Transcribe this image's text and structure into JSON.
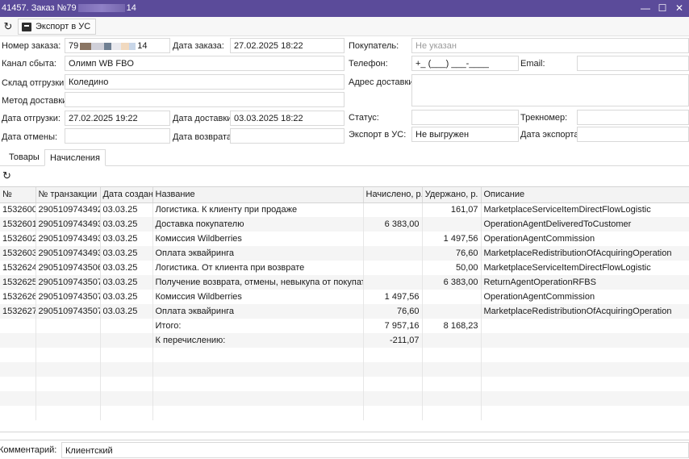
{
  "window": {
    "title_prefix": "41457. Заказ №79",
    "title_suffix": "14",
    "minimize": "—",
    "maximize": "☐",
    "close": "✕"
  },
  "toolbar": {
    "export_label": "Экспорт в УС"
  },
  "form": {
    "order_number_label": "Номер заказа:",
    "order_number_prefix": "79",
    "order_number_suffix": "14",
    "order_date_label": "Дата заказа:",
    "order_date": "27.02.2025 18:22",
    "buyer_label": "Покупатель:",
    "buyer_placeholder": "Не указан",
    "channel_label": "Канал сбыта:",
    "channel": "Олимп WB FBO",
    "phone_label": "Телефон:",
    "phone_mask": "+_ (___) ___-____",
    "email_label": "Email:",
    "email": "",
    "warehouse_label": "Склад отгрузки:",
    "warehouse": "Коледино",
    "address_label": "Адрес доставки:",
    "address": "",
    "delivery_method_label": "Метод доставки:",
    "delivery_method": "",
    "ship_date_label": "Дата отгрузки:",
    "ship_date": "27.02.2025 19:22",
    "delivery_date_label": "Дата доставки:",
    "delivery_date": "03.03.2025 18:22",
    "status_label": "Статус:",
    "status": "",
    "track_label": "Трекномер:",
    "track": "",
    "cancel_date_label": "Дата отмены:",
    "cancel_date": "",
    "return_date_label": "Дата возврата:",
    "return_date": "",
    "export_us_label": "Экспорт в УС:",
    "export_us": "Не выгружен",
    "export_date_label": "Дата экспорта:",
    "export_date": ""
  },
  "tabs": [
    {
      "label": "Товары",
      "active": false
    },
    {
      "label": "Начисления",
      "active": true
    }
  ],
  "grid": {
    "columns": [
      "№",
      "№ транзакции",
      "Дата создан...",
      "Название",
      "Начислено, р.",
      "Удержано, р.",
      "Описание"
    ],
    "rows": [
      [
        "1532600",
        "2905109743492",
        "03.03.25",
        "Логистика. К клиенту при продаже",
        "",
        "161,07",
        "MarketplaceServiceItemDirectFlowLogistic"
      ],
      [
        "1532601",
        "2905109743493...",
        "03.03.25",
        "Доставка покупателю",
        "6 383,00",
        "",
        "OperationAgentDeliveredToCustomer"
      ],
      [
        "1532602",
        "2905109743493...",
        "03.03.25",
        "Комиссия Wildberries",
        "",
        "1 497,56",
        "OperationAgentCommission"
      ],
      [
        "1532603",
        "2905109743493...",
        "03.03.25",
        "Оплата эквайринга",
        "",
        "76,60",
        "MarketplaceRedistributionOfAcquiringOperation"
      ],
      [
        "1532624",
        "2905109743506",
        "03.03.25",
        "Логистика. От клиента при возврате",
        "",
        "50,00",
        "MarketplaceServiceItemDirectFlowLogistic"
      ],
      [
        "1532625",
        "2905109743507...",
        "03.03.25",
        "Получение возврата, отмены, невыкупа от покупателя",
        "",
        "6 383,00",
        "ReturnAgentOperationRFBS"
      ],
      [
        "1532626",
        "2905109743507...",
        "03.03.25",
        "Комиссия Wildberries",
        "1 497,56",
        "",
        "OperationAgentCommission"
      ],
      [
        "1532627",
        "2905109743507...",
        "03.03.25",
        "Оплата эквайринга",
        "76,60",
        "",
        "MarketplaceRedistributionOfAcquiringOperation"
      ],
      [
        "",
        "",
        "",
        "Итого:",
        "7 957,16",
        "8 168,23",
        ""
      ],
      [
        "",
        "",
        "",
        "К перечислению:",
        "-211,07",
        "",
        ""
      ]
    ]
  },
  "comment": {
    "label": "Комментарий:",
    "value": "Клиентский"
  }
}
